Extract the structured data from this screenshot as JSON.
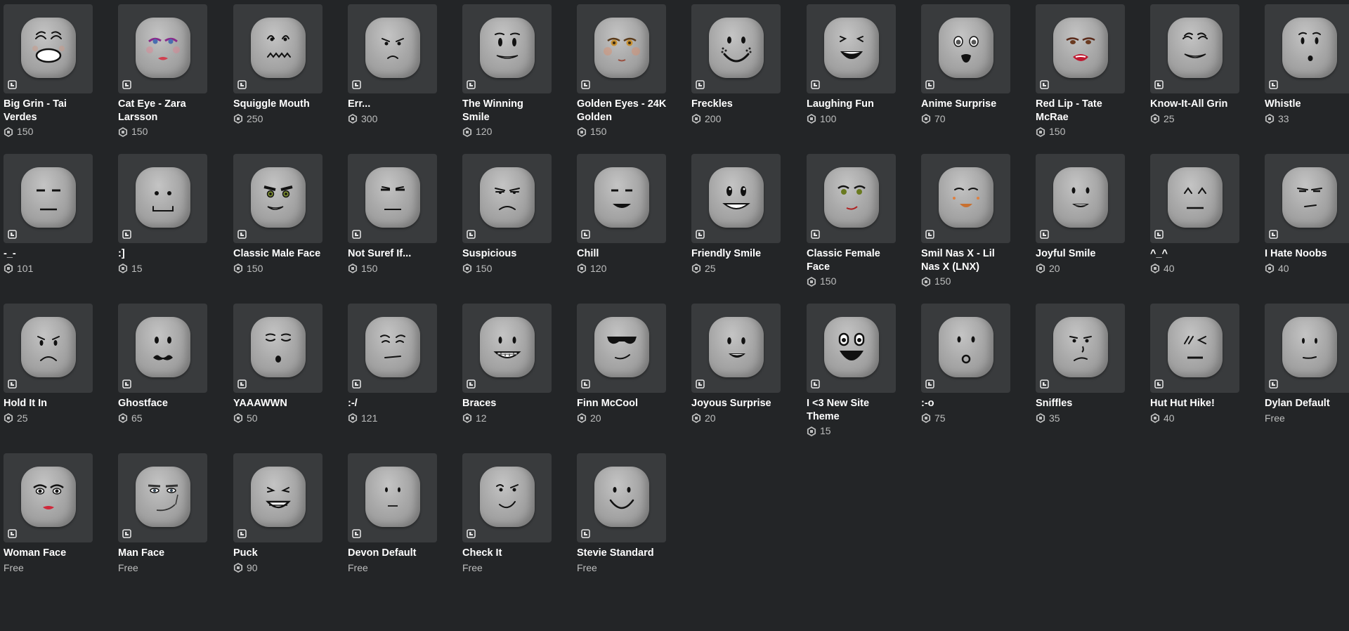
{
  "items": [
    {
      "name": "Big Grin - Tai Verdes",
      "price": "150",
      "face": "big-grin-tai-verdes"
    },
    {
      "name": "Cat Eye - Zara Larsson",
      "price": "150",
      "face": "cat-eye-zara-larsson"
    },
    {
      "name": "Squiggle Mouth",
      "price": "250",
      "face": "squiggle-mouth"
    },
    {
      "name": "Err...",
      "price": "300",
      "face": "err"
    },
    {
      "name": "The Winning Smile",
      "price": "120",
      "face": "the-winning-smile"
    },
    {
      "name": "Golden Eyes - 24K Golden",
      "price": "150",
      "face": "golden-eyes"
    },
    {
      "name": "Freckles",
      "price": "200",
      "face": "freckles"
    },
    {
      "name": "Laughing Fun",
      "price": "100",
      "face": "laughing-fun"
    },
    {
      "name": "Anime Surprise",
      "price": "70",
      "face": "anime-surprise"
    },
    {
      "name": "Red Lip - Tate McRae",
      "price": "150",
      "face": "red-lip-tate-mcrae"
    },
    {
      "name": "Know-It-All Grin",
      "price": "25",
      "face": "know-it-all-grin"
    },
    {
      "name": "Whistle",
      "price": "33",
      "face": "whistle"
    },
    {
      "name": "-_-",
      "price": "101",
      "face": "dash-underscore-dash"
    },
    {
      "name": ":]",
      "price": "15",
      "face": "colon-bracket"
    },
    {
      "name": "Classic Male Face",
      "price": "150",
      "face": "classic-male-face"
    },
    {
      "name": "Not Suref If...",
      "price": "150",
      "face": "not-sure-if"
    },
    {
      "name": "Suspicious",
      "price": "150",
      "face": "suspicious"
    },
    {
      "name": "Chill",
      "price": "120",
      "face": "chill"
    },
    {
      "name": "Friendly Smile",
      "price": "25",
      "face": "friendly-smile"
    },
    {
      "name": "Classic Female Face",
      "price": "150",
      "face": "classic-female-face"
    },
    {
      "name": "Smil Nas X - Lil Nas X (LNX)",
      "price": "150",
      "face": "smil-nas-x"
    },
    {
      "name": "Joyful Smile",
      "price": "20",
      "face": "joyful-smile"
    },
    {
      "name": "^_^",
      "price": "40",
      "face": "caret-smile"
    },
    {
      "name": "I Hate Noobs",
      "price": "40",
      "face": "i-hate-noobs"
    },
    {
      "name": "Hold It In",
      "price": "25",
      "face": "hold-it-in"
    },
    {
      "name": "Ghostface",
      "price": "65",
      "face": "ghostface"
    },
    {
      "name": "YAAAWWN",
      "price": "50",
      "face": "yaaawwn"
    },
    {
      "name": ":-/",
      "price": "121",
      "face": "colon-dash-slash"
    },
    {
      "name": "Braces",
      "price": "12",
      "face": "braces"
    },
    {
      "name": "Finn McCool",
      "price": "20",
      "face": "finn-mccool"
    },
    {
      "name": "Joyous Surprise",
      "price": "20",
      "face": "joyous-surprise"
    },
    {
      "name": "I <3 New Site Theme",
      "price": "15",
      "face": "i-heart-new-site-theme"
    },
    {
      "name": ":-o",
      "price": "75",
      "face": "colon-dash-o"
    },
    {
      "name": "Sniffles",
      "price": "35",
      "face": "sniffles"
    },
    {
      "name": "Hut Hut Hike!",
      "price": "40",
      "face": "hut-hut-hike"
    },
    {
      "name": "Dylan Default",
      "price": "Free",
      "face": "dylan-default"
    },
    {
      "name": "Woman Face",
      "price": "Free",
      "face": "woman-face"
    },
    {
      "name": "Man Face",
      "price": "Free",
      "face": "man-face"
    },
    {
      "name": "Puck",
      "price": "90",
      "face": "puck"
    },
    {
      "name": "Devon Default",
      "price": "Free",
      "face": "devon-default"
    },
    {
      "name": "Check It",
      "price": "Free",
      "face": "check-it"
    },
    {
      "name": "Stevie Standard",
      "price": "Free",
      "face": "stevie-standard"
    }
  ]
}
